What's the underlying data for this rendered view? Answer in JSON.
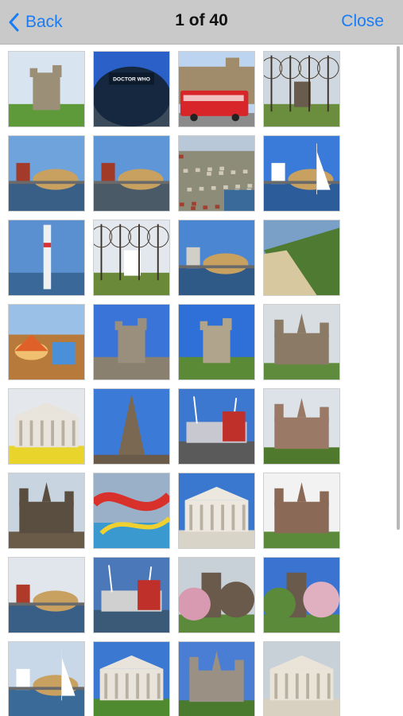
{
  "navbar": {
    "back_label": "Back",
    "title": "1 of 40",
    "close_label": "Close"
  },
  "photos": [
    {
      "name": "castle-keep-on-hill",
      "sky": "#d8e4f0",
      "ground": "#5f9a3a",
      "subject": "#9c8f78",
      "kind": "keep"
    },
    {
      "name": "doctor-who-experience",
      "sky": "#2a60c8",
      "ground": "#3b4a5a",
      "subject": "#15283f",
      "kind": "dome-building",
      "label": "DOCTOR WHO EXPERIENCE"
    },
    {
      "name": "red-tour-bus-castle",
      "sky": "#bcd4f0",
      "ground": "#8b8b8b",
      "subject": "#a08c6a",
      "kind": "bus"
    },
    {
      "name": "winter-trees-castle",
      "sky": "#cfd8e0",
      "ground": "#6b8e3e",
      "subject": "#6a5c4c",
      "kind": "trees"
    },
    {
      "name": "bay-waterfront-red-building",
      "sky": "#6fa3dc",
      "ground": "#3a5f86",
      "subject": "#a33a2a",
      "kind": "waterfront"
    },
    {
      "name": "pierhead-building-bay",
      "sky": "#5e96d8",
      "ground": "#4a5a66",
      "subject": "#a23a28",
      "kind": "waterfront"
    },
    {
      "name": "aerial-city-view",
      "sky": "#b8c8d8",
      "ground": "#8c8c78",
      "subject": "#d0c8b8",
      "kind": "aerial"
    },
    {
      "name": "marina-with-boats",
      "sky": "#3a7ad8",
      "ground": "#2c5c9a",
      "subject": "#ffffff",
      "kind": "marina"
    },
    {
      "name": "white-lighthouse-tower",
      "sky": "#5a90d0",
      "ground": "#3a6898",
      "subject": "#f0f0f0",
      "kind": "tower"
    },
    {
      "name": "avenue-of-trees-house",
      "sky": "#e2e8ee",
      "ground": "#6a8a3a",
      "subject": "#ffffff",
      "kind": "avenue"
    },
    {
      "name": "bay-with-norwegian-church",
      "sky": "#4a86d2",
      "ground": "#2f5a88",
      "subject": "#d0d0c8",
      "kind": "waterfront"
    },
    {
      "name": "coastal-beach-cliffs",
      "sky": "#7aa0c8",
      "ground": "#d8c8a0",
      "subject": "#4f7a32",
      "kind": "beach"
    },
    {
      "name": "funfair-carousel",
      "sky": "#9ac0e8",
      "ground": "#b87a3a",
      "subject": "#e0602a",
      "kind": "fair"
    },
    {
      "name": "castle-tower-blue-sky",
      "sky": "#3a74d8",
      "ground": "#8a8070",
      "subject": "#9a8e7c",
      "kind": "tower-stone"
    },
    {
      "name": "castle-keep-with-flag",
      "sky": "#2e6fd8",
      "ground": "#5a8a36",
      "subject": "#b0a48c",
      "kind": "keep"
    },
    {
      "name": "gothic-castle-hall",
      "sky": "#d8dde2",
      "ground": "#5f8c3c",
      "subject": "#8a7a66",
      "kind": "castle"
    },
    {
      "name": "white-civic-building-daffodils",
      "sky": "#e4e8ec",
      "ground": "#e8d42a",
      "subject": "#e8e4dc",
      "kind": "civic"
    },
    {
      "name": "church-spire-clouds",
      "sky": "#3c7ad8",
      "ground": "#6a5a4a",
      "subject": "#7a6852",
      "kind": "spire"
    },
    {
      "name": "millennium-stadium",
      "sky": "#3d78d0",
      "ground": "#5a5a5a",
      "subject": "#c8c8d0",
      "kind": "stadium"
    },
    {
      "name": "castell-coch-forest",
      "sky": "#dce2e8",
      "ground": "#4f7a2e",
      "subject": "#9a7a66",
      "kind": "castle"
    },
    {
      "name": "castle-walls-clock-tower",
      "sky": "#c8d4e0",
      "ground": "#6a5a48",
      "subject": "#5a4e40",
      "kind": "walls"
    },
    {
      "name": "water-slides-pool",
      "sky": "#9ab0c8",
      "ground": "#3a9ad0",
      "subject": "#d8302a",
      "kind": "slides"
    },
    {
      "name": "city-hall-dome",
      "sky": "#3a78d0",
      "ground": "#d8d4c8",
      "subject": "#ece8e0",
      "kind": "civic"
    },
    {
      "name": "cardiff-castle-towers",
      "sky": "#f2f2f2",
      "ground": "#5a8a3a",
      "subject": "#8a6a56",
      "kind": "castle"
    },
    {
      "name": "pierhead-and-wmc",
      "sky": "#e0e6ec",
      "ground": "#3a5f86",
      "subject": "#b03a2a",
      "kind": "waterfront"
    },
    {
      "name": "bay-sunset-clouds",
      "sky": "#4a78b8",
      "ground": "#3a5a78",
      "subject": "#d0d0d0",
      "kind": "stadium"
    },
    {
      "name": "blossom-castle",
      "sky": "#c8d0d8",
      "ground": "#d89ab0",
      "subject": "#6a5a4c",
      "kind": "blossom"
    },
    {
      "name": "tower-blossom-trees",
      "sky": "#3a74d0",
      "ground": "#5a8a3a",
      "subject": "#e0b0c0",
      "kind": "blossom"
    },
    {
      "name": "bay-sailboat",
      "sky": "#c8d8e8",
      "ground": "#3a6a98",
      "subject": "#ffffff",
      "kind": "sailboat"
    },
    {
      "name": "white-palace-lawn",
      "sky": "#3a78d2",
      "ground": "#4f8a30",
      "subject": "#e8e4dc",
      "kind": "civic"
    },
    {
      "name": "gothic-cathedral-towers",
      "sky": "#4a7ed4",
      "ground": "#4a7a2e",
      "subject": "#9a9084",
      "kind": "castle"
    },
    {
      "name": "columned-museum-entrance",
      "sky": "#c8d0d8",
      "ground": "#d8d0c0",
      "subject": "#eae4d8",
      "kind": "columns"
    }
  ]
}
